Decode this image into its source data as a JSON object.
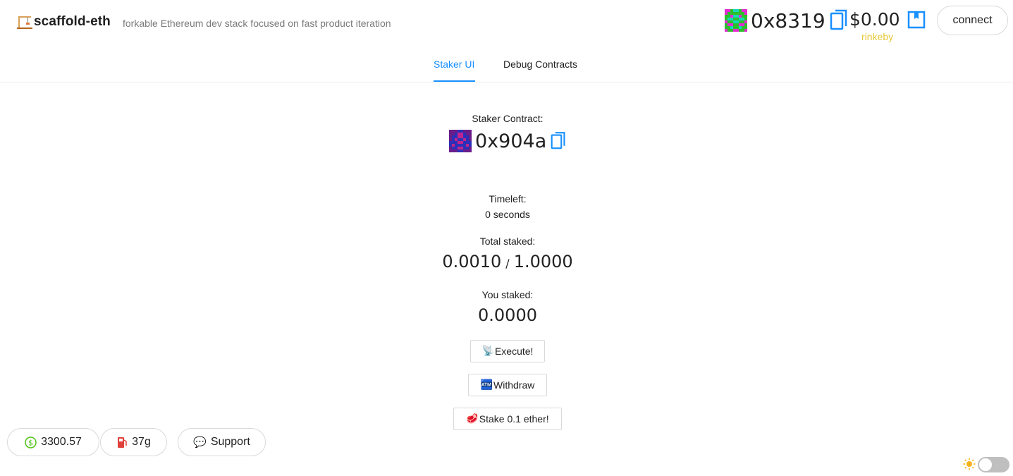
{
  "header": {
    "title": "scaffold-eth",
    "subtitle": "forkable Ethereum dev stack focused on fast product iteration",
    "account_address": "0x8319",
    "balance": "$0.00",
    "network": "rinkeby",
    "connect_label": "connect"
  },
  "tabs": [
    {
      "label": "Staker UI",
      "active": true
    },
    {
      "label": "Debug Contracts",
      "active": false
    }
  ],
  "main": {
    "contract_label": "Staker Contract:",
    "contract_address": "0x904a",
    "timeleft_label": "Timeleft:",
    "timeleft_value": "0 seconds",
    "total_staked_label": "Total staked:",
    "total_staked": "0.0010",
    "threshold": "1.0000",
    "separator": "/",
    "you_staked_label": "You staked:",
    "you_staked": "0.0000",
    "buttons": {
      "execute": {
        "emoji": "📡",
        "label": "Execute!"
      },
      "withdraw": {
        "emoji": "🏧",
        "label": "Withdraw"
      },
      "stake": {
        "emoji": "🥩",
        "label": "Stake 0.1 ether!"
      }
    }
  },
  "footer": {
    "price": "3300.57",
    "gas": "37g",
    "support": "Support",
    "support_emoji": "💬",
    "theme_dark": false
  },
  "colors": {
    "accent": "#1890ff",
    "network": "#e6c83a",
    "price_icon": "#52c41a"
  }
}
